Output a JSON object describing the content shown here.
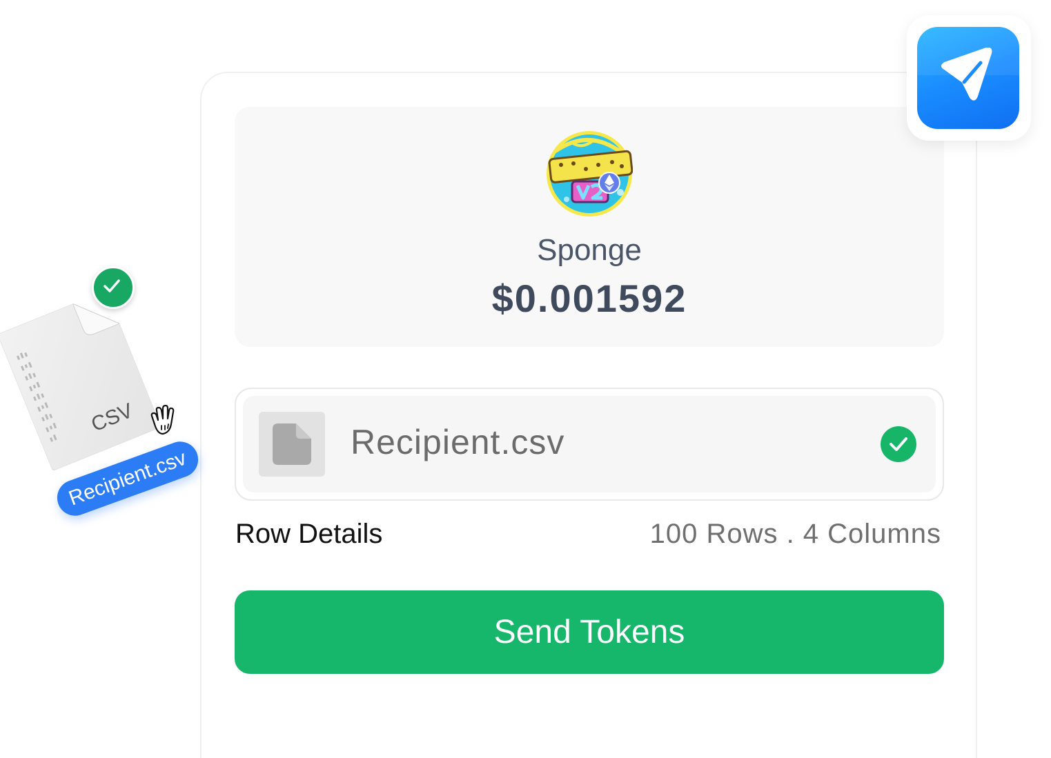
{
  "token": {
    "name": "Sponge",
    "price": "$0.001592",
    "logo_icon": "sponge-v2-logo-icon",
    "logo_text": "Sponge V2"
  },
  "upload": {
    "file_name": "Recipient.csv",
    "file_icon": "document-icon",
    "status_icon": "check-circle-icon",
    "status_color": "#16b567"
  },
  "row_details": {
    "label": "Row Details",
    "value": "100 Rows . 4 Columns"
  },
  "actions": {
    "send_label": "Send Tokens",
    "send_color": "#16b76b"
  },
  "app_icon": {
    "icon": "paper-plane-icon",
    "color": "#1a8cff"
  },
  "drag_illustration": {
    "file_type": "CSV",
    "file_label": "Recipient.csv",
    "check_icon": "check-circle-icon",
    "cursor_icon": "hand-cursor-icon"
  }
}
